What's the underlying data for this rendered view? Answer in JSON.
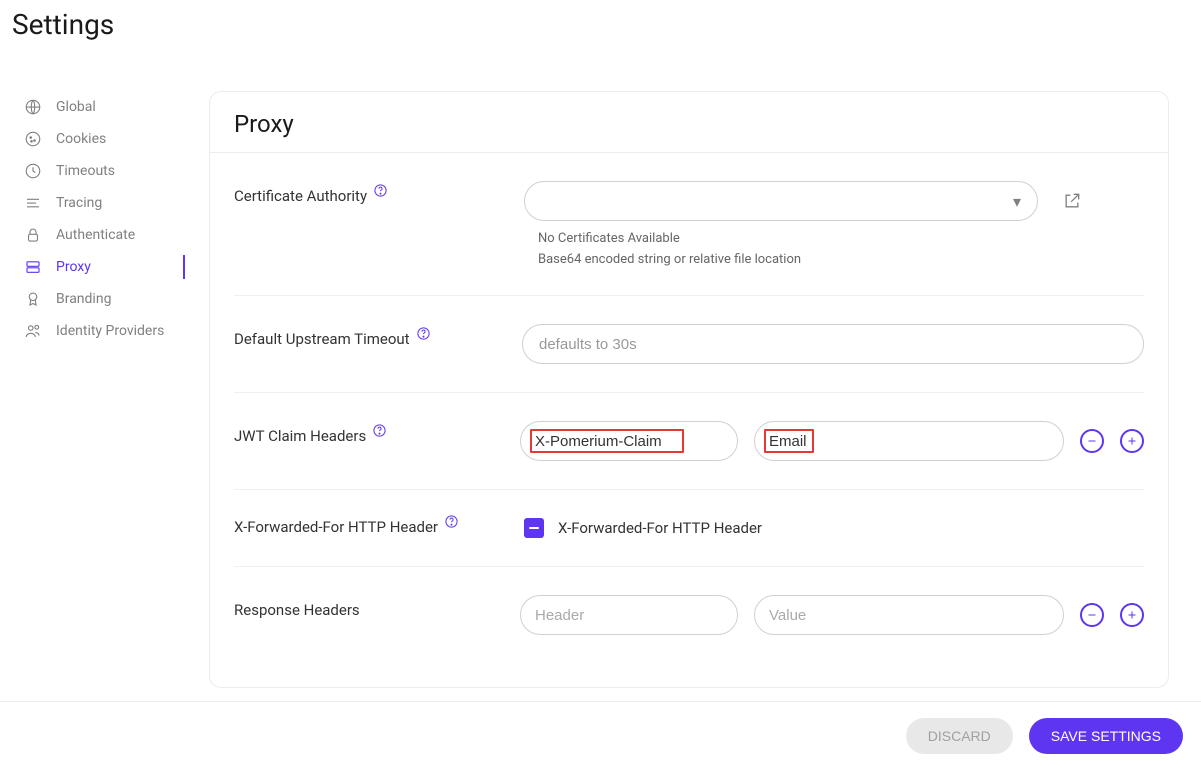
{
  "page": {
    "title": "Settings"
  },
  "sidebar": {
    "items": [
      {
        "label": "Global"
      },
      {
        "label": "Cookies"
      },
      {
        "label": "Timeouts"
      },
      {
        "label": "Tracing"
      },
      {
        "label": "Authenticate"
      },
      {
        "label": "Proxy"
      },
      {
        "label": "Branding"
      },
      {
        "label": "Identity Providers"
      }
    ],
    "activeIndex": 5
  },
  "panel": {
    "title": "Proxy",
    "cert_authority": {
      "label": "Certificate Authority",
      "no_certs": "No Certificates Available",
      "hint": "Base64 encoded string or relative file location"
    },
    "upstream_timeout": {
      "label": "Default Upstream Timeout",
      "placeholder": "defaults to 30s",
      "value": ""
    },
    "jwt_claims": {
      "label": "JWT Claim Headers",
      "header_value": "X-Pomerium-Claim",
      "claim_value": "Email"
    },
    "xff": {
      "label": "X-Forwarded-For HTTP Header",
      "checkbox_label": "X-Forwarded-For HTTP Header"
    },
    "response_headers": {
      "label": "Response Headers",
      "header_placeholder": "Header",
      "value_placeholder": "Value",
      "header_value": "",
      "value_value": ""
    }
  },
  "footer": {
    "discard": "DISCARD",
    "save": "SAVE SETTINGS"
  }
}
